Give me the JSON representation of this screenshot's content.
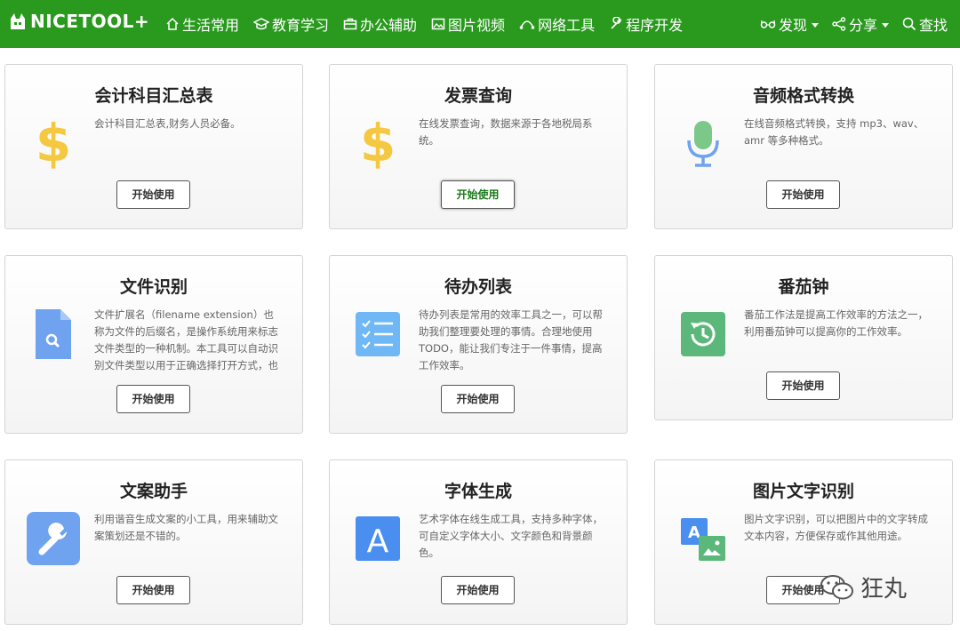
{
  "navbar": {
    "logo_text": "NICETOOL+",
    "left_items": [
      {
        "label": "生活常用",
        "icon": "home-icon"
      },
      {
        "label": "教育学习",
        "icon": "graduation-cap-icon"
      },
      {
        "label": "办公辅助",
        "icon": "briefcase-icon"
      },
      {
        "label": "图片视频",
        "icon": "image-icon"
      },
      {
        "label": "网络工具",
        "icon": "network-icon"
      },
      {
        "label": "程序开发",
        "icon": "wrench-icon"
      }
    ],
    "right_items": [
      {
        "label": "发现",
        "icon": "glasses-icon"
      },
      {
        "label": "分享",
        "icon": "share-icon"
      },
      {
        "label": "查找",
        "icon": "search-icon"
      }
    ]
  },
  "cards": [
    {
      "title": "会计科目汇总表",
      "desc": "会计科目汇总表,财务人员必备。",
      "button": "开始使用",
      "icon": "dollar-icon"
    },
    {
      "title": "发票查询",
      "desc": "在线发票查询，数据来源于各地税局系统。",
      "button": "开始使用",
      "icon": "dollar-icon"
    },
    {
      "title": "音频格式转换",
      "desc": "在线音频格式转换，支持 mp3、wav、amr 等多种格式。",
      "button": "开始使用",
      "icon": "microphone-icon"
    },
    {
      "title": "文件识别",
      "desc": "文件扩展名（filename extension）也称为文件的后缀名，是操作系统用来标志文件类型的一种机制。本工具可以自动识别文件类型以用于正确选择打开方式，也可",
      "button": "开始使用",
      "icon": "file-search-icon"
    },
    {
      "title": "待办列表",
      "desc": "待办列表是常用的效率工具之一，可以帮助我们整理要处理的事情。合理地使用 TODO，能让我们专注于一件事情，提高工作效率。",
      "button": "开始使用",
      "icon": "checklist-icon"
    },
    {
      "title": "番茄钟",
      "desc": "番茄工作法是提高工作效率的方法之一，利用番茄钟可以提高你的工作效率。",
      "button": "开始使用",
      "icon": "history-clock-icon"
    },
    {
      "title": "文案助手",
      "desc": "利用谐音生成文案的小工具，用来辅助文案策划还是不错的。",
      "button": "开始使用",
      "icon": "wrench-icon"
    },
    {
      "title": "字体生成",
      "desc": "艺术字体在线生成工具，支持多种字体，可自定义字体大小、文字颜色和背景颜色。",
      "button": "开始使用",
      "icon": "letter-a-icon"
    },
    {
      "title": "图片文字识别",
      "desc": "图片文字识别，可以把图片中的文字转成文本内容，方便保存或作其他用途。",
      "button": "开始使用",
      "icon": "image-to-text-icon"
    }
  ],
  "watermark": {
    "text": "狂丸"
  },
  "colors": {
    "navbar_bg": "#2a9a1f",
    "dollar": "#f5c842",
    "blue_icon": "#6fa3ef",
    "green_icon": "#5cb87a"
  }
}
